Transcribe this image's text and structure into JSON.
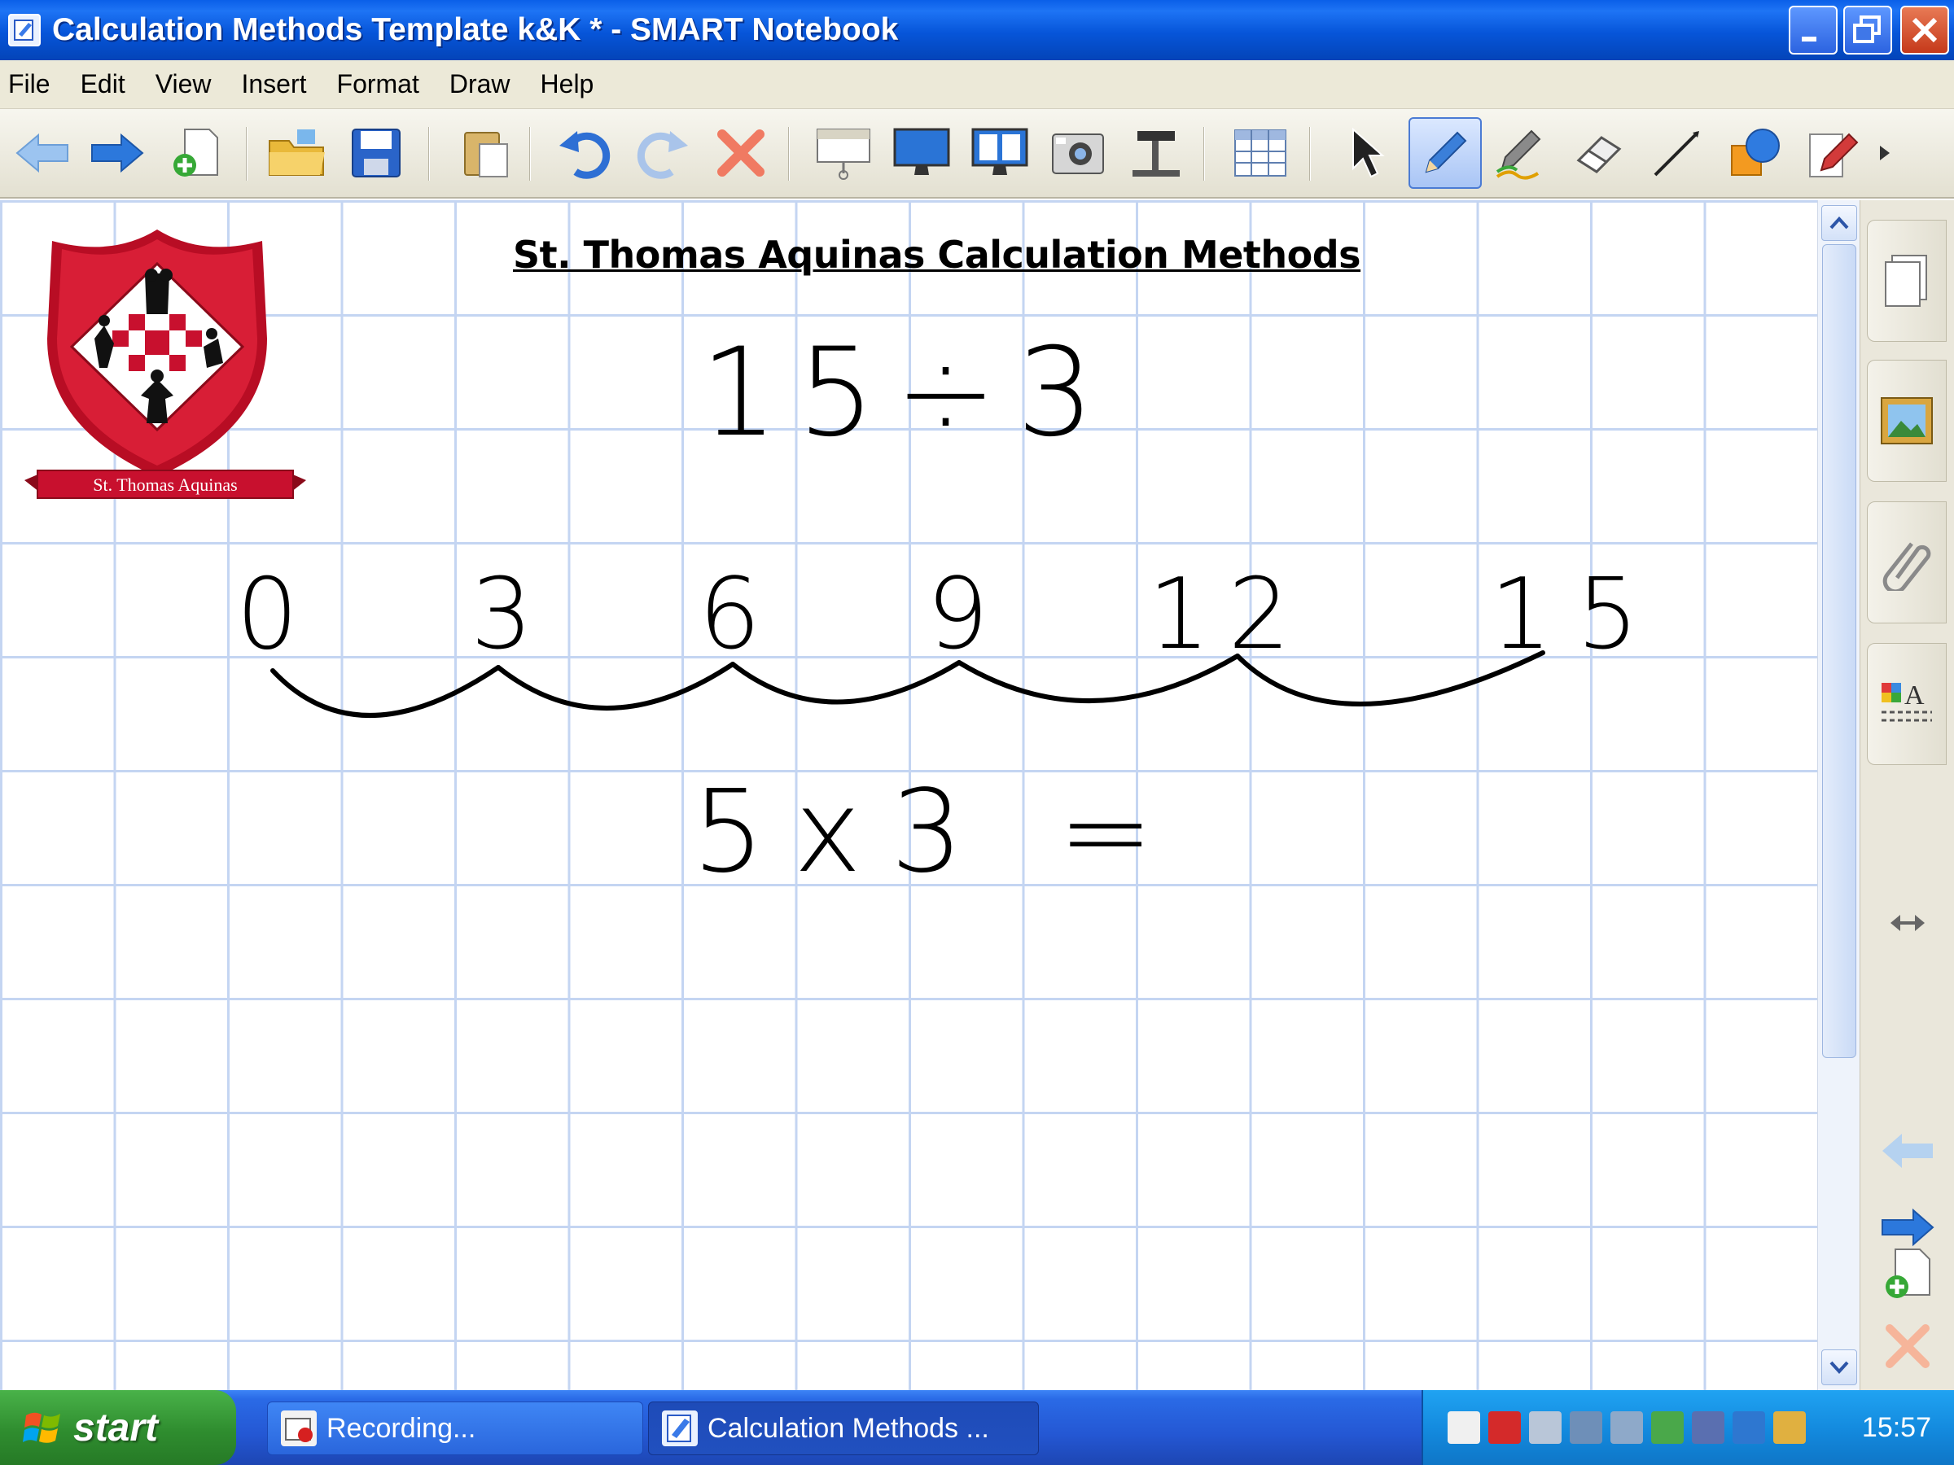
{
  "window": {
    "title": "Calculation Methods Template k&K * - SMART Notebook"
  },
  "menu": [
    "File",
    "Edit",
    "View",
    "Insert",
    "Format",
    "Draw",
    "Help"
  ],
  "toolbar": {
    "icons": [
      "back-arrow-icon",
      "forward-arrow-icon",
      "add-page-icon",
      "open-folder-icon",
      "save-icon",
      "paste-icon",
      "undo-icon",
      "redo-icon",
      "delete-icon",
      "screen-shade-icon",
      "full-screen-icon",
      "dual-page-icon",
      "screen-capture-icon",
      "document-camera-icon",
      "table-icon",
      "select-icon",
      "pen-icon",
      "creative-pen-icon",
      "eraser-icon",
      "line-icon",
      "shapes-icon",
      "magic-pen-icon",
      "more-icon"
    ],
    "active_tool": "pen-icon"
  },
  "page": {
    "title": "St. Thomas Aquinas Calculation Methods",
    "logo_text": "St. Thomas Aquinas",
    "problem": "15÷3",
    "number_line": [
      "0",
      "3",
      "6",
      "9",
      "12",
      "15"
    ],
    "answer_equation": "5x3 ="
  },
  "side_tabs": [
    "page-sorter-icon",
    "gallery-icon",
    "attachments-icon",
    "properties-icon"
  ],
  "side_nav": [
    "resize-arrow-icon",
    "previous-page-icon",
    "next-page-icon",
    "add-page-icon",
    "delete-page-icon"
  ],
  "taskbar": {
    "start_label": "start",
    "tasks": [
      {
        "label": "Recording...",
        "active": false
      },
      {
        "label": "Calculation Methods ...",
        "active": true
      }
    ],
    "clock": "15:57"
  },
  "colors": {
    "titlebar": "#0655d9",
    "grid_line": "#c4d5f2",
    "logo_red": "#c8102e",
    "taskbar": "#2457d3",
    "start_green": "#2f8d2f"
  }
}
